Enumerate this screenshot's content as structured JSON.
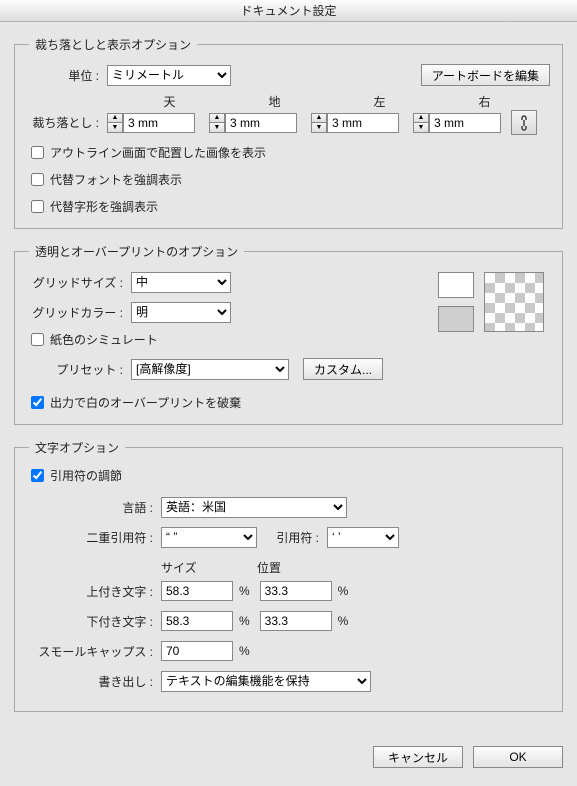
{
  "title": "ドキュメント設定",
  "section1": {
    "legend": "裁ち落としと表示オプション",
    "unit_label": "単位 :",
    "unit_value": "ミリメートル",
    "edit_artboards": "アートボードを編集",
    "bleed_label": "裁ち落とし :",
    "top": "天",
    "bottom": "地",
    "left": "左",
    "right": "右",
    "bleed_top": "3 mm",
    "bleed_bottom": "3 mm",
    "bleed_left": "3 mm",
    "bleed_right": "3 mm",
    "chk_outline": "アウトライン画面で配置した画像を表示",
    "chk_altfont": "代替フォントを強調表示",
    "chk_altglyph": "代替字形を強調表示"
  },
  "section2": {
    "legend": "透明とオーバープリントのオプション",
    "grid_size_label": "グリッドサイズ :",
    "grid_size_value": "中",
    "grid_color_label": "グリッドカラー :",
    "grid_color_value": "明",
    "chk_simulate_paper": "紙色のシミュレート",
    "preset_label": "プリセット :",
    "preset_value": "[高解像度]",
    "custom_btn": "カスタム...",
    "chk_discard_white": "出力で白のオーバープリントを破棄"
  },
  "section3": {
    "legend": "文字オプション",
    "chk_quotes": "引用符の調節",
    "lang_label": "言語 :",
    "lang_value": "英語：米国",
    "dquote_label": "二重引用符 :",
    "dquote_value": "“ ”",
    "squote_label": "引用符 :",
    "squote_value": "‘ ’",
    "size_header": "サイズ",
    "pos_header": "位置",
    "super_label": "上付き文字 :",
    "super_size": "58.3",
    "super_pos": "33.3",
    "sub_label": "下付き文字 :",
    "sub_size": "58.3",
    "sub_pos": "33.3",
    "smallcaps_label": "スモールキャップス :",
    "smallcaps_value": "70",
    "percent": "%",
    "export_label": "書き出し :",
    "export_value": "テキストの編集機能を保持"
  },
  "footer": {
    "cancel": "キャンセル",
    "ok": "OK"
  }
}
